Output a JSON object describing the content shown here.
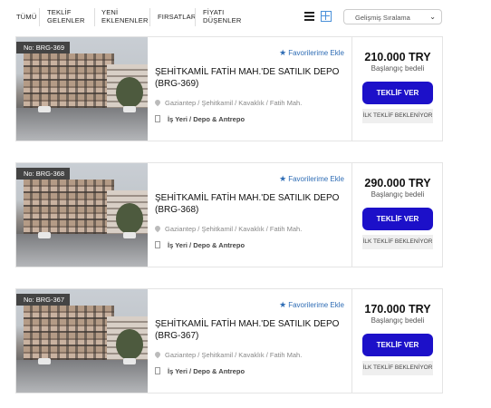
{
  "filters": {
    "tabs": [
      {
        "line1": "TÜMÜ",
        "line2": ""
      },
      {
        "line1": "TEKLİF",
        "line2": "GELENLER"
      },
      {
        "line1": "YENİ",
        "line2": "EKLENENLER"
      },
      {
        "line1": "FIRSATLAR",
        "line2": ""
      },
      {
        "line1": "FİYATI",
        "line2": "DÜŞENLER"
      }
    ],
    "sort_label": "Gelişmiş Sıralama",
    "active_view": "grid"
  },
  "listings": [
    {
      "badge": "No: BRG-369",
      "favorite_label": "Favorilerime Ekle",
      "title": "ŞEHİTKAMİL FATİH MAH.'DE SATILIK DEPO (BRG-369)",
      "location": "Gaziantep / Şehitkamil / Kavaklık / Fatih Mah.",
      "category": "İş Yeri / Depo & Antrepo",
      "price": "210.000 TRY",
      "price_label": "Başlangıç bedeli",
      "bid_button": "TEKLİF VER",
      "status": "İLK TEKLİF BEKLENİYOR"
    },
    {
      "badge": "No: BRG-368",
      "favorite_label": "Favorilerime Ekle",
      "title": "ŞEHİTKAMİL FATİH MAH.'DE SATILIK DEPO (BRG-368)",
      "location": "Gaziantep / Şehitkamil / Kavaklık / Fatih Mah.",
      "category": "İş Yeri / Depo & Antrepo",
      "price": "290.000 TRY",
      "price_label": "Başlangıç bedeli",
      "bid_button": "TEKLİF VER",
      "status": "İLK TEKLİF BEKLENİYOR"
    },
    {
      "badge": "No: BRG-367",
      "favorite_label": "Favorilerime Ekle",
      "title": "ŞEHİTKAMİL FATİH MAH.'DE SATILIK DEPO (BRG-367)",
      "location": "Gaziantep / Şehitkamil / Kavaklık / Fatih Mah.",
      "category": "İş Yeri / Depo & Antrepo",
      "price": "170.000 TRY",
      "price_label": "Başlangıç bedeli",
      "bid_button": "TEKLİF VER",
      "status": "İLK TEKLİF BEKLENİYOR"
    }
  ],
  "colors": {
    "bid_button": "#1c10c9",
    "favorite": "#2f6db5",
    "badge": "#444444"
  }
}
